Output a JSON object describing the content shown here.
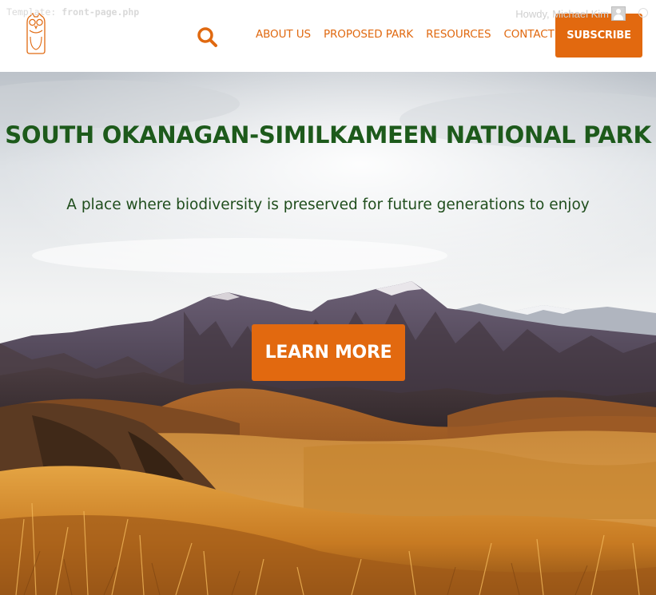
{
  "admin": {
    "template_label": "Template:",
    "template_file": "front-page.php",
    "greeting": "Howdy, Michael Kim"
  },
  "header": {
    "logo": "owl-logo-icon",
    "search_icon": "search-icon",
    "nav": [
      {
        "label": "ABOUT US"
      },
      {
        "label": "PROPOSED PARK"
      },
      {
        "label": "RESOURCES"
      },
      {
        "label": "CONTACT US"
      }
    ],
    "subscribe_label": "SUBSCRIBE"
  },
  "hero": {
    "title": "SOUTH OKANAGAN-SIMILKAMEEN NATIONAL PARK",
    "subtitle": "A place where biodiversity is preserved for future generations to enjoy",
    "cta_label": "LEARN MORE",
    "image": "mountain-grassland-landscape"
  },
  "colors": {
    "accent": "#e2690f",
    "title_green": "#1d5a1b",
    "text_green": "#1f4d1c"
  }
}
